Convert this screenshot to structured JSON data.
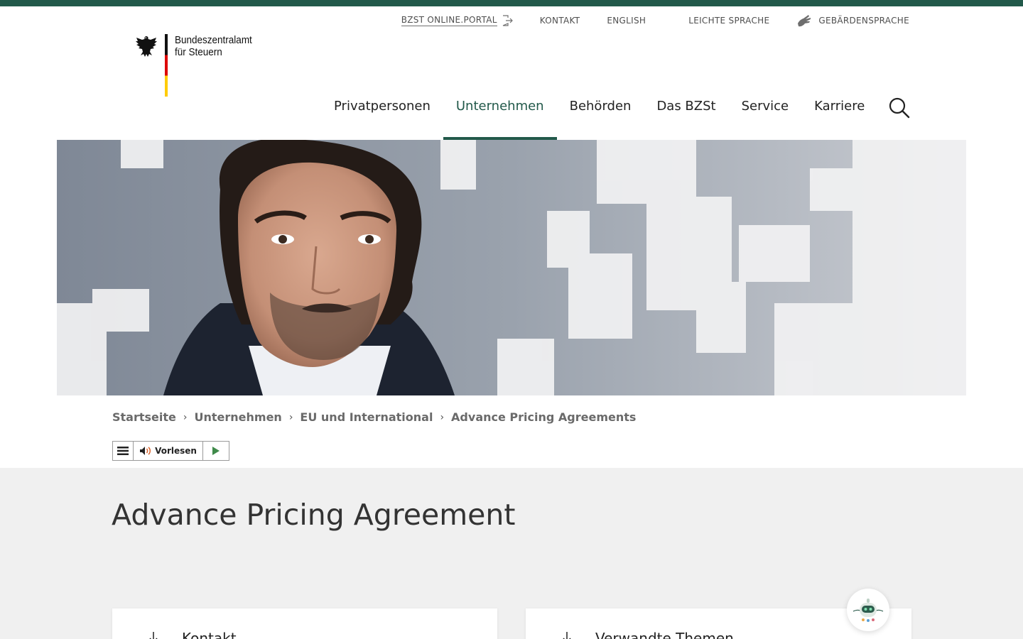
{
  "service_nav": {
    "portal_label": "BZST ONLINE.PORTAL",
    "kontakt_label": "KONTAKT",
    "english_label": "ENGLISH",
    "leichte_label": "LEICHTE SPRACHE",
    "gebaerden_label": "GEBÄRDENSPRACHE"
  },
  "logo": {
    "line1": "Bundeszentralamt",
    "line2": "für Steuern"
  },
  "main_nav": {
    "items": [
      {
        "label": "Privatpersonen"
      },
      {
        "label": "Unternehmen",
        "active": true
      },
      {
        "label": "Behörden"
      },
      {
        "label": "Das BZSt"
      },
      {
        "label": "Service"
      },
      {
        "label": "Karriere"
      }
    ],
    "search_icon": "search-icon"
  },
  "breadcrumb": {
    "items": [
      "Startseite",
      "Unternehmen",
      "EU und International",
      "Advance Pricing Agreements"
    ],
    "separator": "›"
  },
  "reader": {
    "label": "Vorlesen"
  },
  "page": {
    "title": "Advance Pricing Agreement"
  },
  "cards": {
    "left_title": "Kontakt",
    "right_title": "Verwandte Themen"
  },
  "colors": {
    "brand_green": "#22594a",
    "content_bg": "#f0f0f0"
  }
}
